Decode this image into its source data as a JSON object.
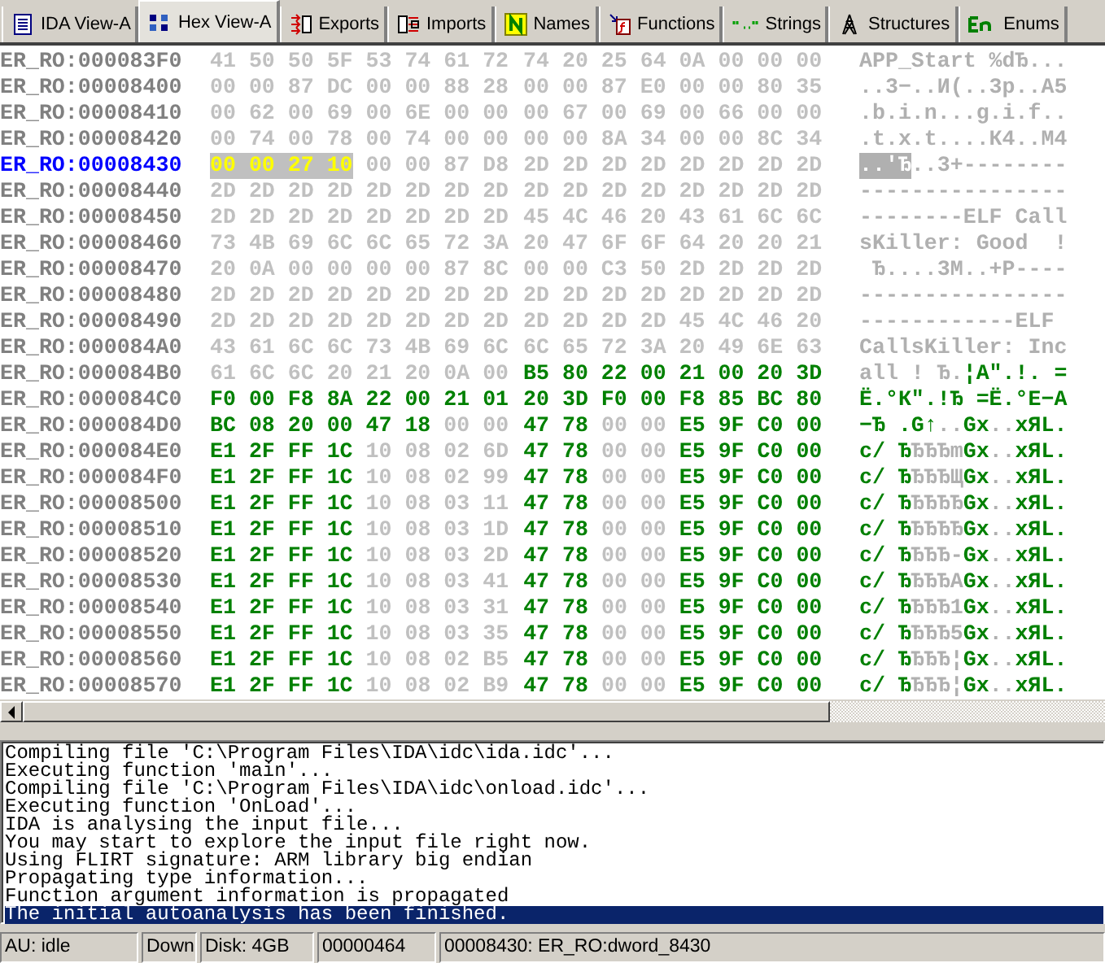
{
  "tabs": [
    {
      "label": "IDA View-A",
      "selected": false
    },
    {
      "label": "Hex View-A",
      "selected": true
    },
    {
      "label": "Exports",
      "selected": false
    },
    {
      "label": "Imports",
      "selected": false
    },
    {
      "label": "Names",
      "selected": false
    },
    {
      "label": "Functions",
      "selected": false
    },
    {
      "label": "Strings",
      "selected": false
    },
    {
      "label": "Structures",
      "selected": false
    },
    {
      "label": "Enums",
      "selected": false
    }
  ],
  "hex_rows": [
    {
      "address": "ER_RO:000083F0",
      "selected": false,
      "segments": [
        {
          "kind": "data",
          "hex": "41 50 50 5F 53 74 61 72",
          "ascii": "APP_Star"
        },
        {
          "kind": "data",
          "hex": "74 20 25 64 0A 00 00 00",
          "ascii": "t %dЂ..."
        }
      ]
    },
    {
      "address": "ER_RO:00008400",
      "selected": false,
      "segments": [
        {
          "kind": "data",
          "hex": "00 00 87 DC 00 00 88 28",
          "ascii": "..3−..И("
        },
        {
          "kind": "data",
          "hex": "00 00 87 E0 00 00 80 35",
          "ascii": "..3р..А5"
        }
      ]
    },
    {
      "address": "ER_RO:00008410",
      "selected": false,
      "segments": [
        {
          "kind": "data",
          "hex": "00 62 00 69 00 6E 00 00",
          "ascii": ".b.i.n.."
        },
        {
          "kind": "data",
          "hex": "00 67 00 69 00 66 00 00",
          "ascii": ".g.i.f.."
        }
      ]
    },
    {
      "address": "ER_RO:00008420",
      "selected": false,
      "segments": [
        {
          "kind": "data",
          "hex": "00 74 00 78 00 74 00 00",
          "ascii": ".t.x.t.."
        },
        {
          "kind": "data",
          "hex": "00 00 8A 34 00 00 8C 34",
          "ascii": "..К4..М4"
        }
      ]
    },
    {
      "address": "ER_RO:00008430",
      "selected": true,
      "segments": [
        {
          "kind": "cursor",
          "hex": "00 00 27 10",
          "ascii": "..'Ђ"
        },
        {
          "kind": "data",
          "hex": "00 00 87 D8",
          "ascii": "..3+"
        },
        {
          "kind": "data",
          "hex": "2D 2D 2D 2D 2D 2D 2D 2D",
          "ascii": "--------"
        }
      ]
    },
    {
      "address": "ER_RO:00008440",
      "selected": false,
      "segments": [
        {
          "kind": "data",
          "hex": "2D 2D 2D 2D 2D 2D 2D 2D",
          "ascii": "--------"
        },
        {
          "kind": "data",
          "hex": "2D 2D 2D 2D 2D 2D 2D 2D",
          "ascii": "--------"
        }
      ]
    },
    {
      "address": "ER_RO:00008450",
      "selected": false,
      "segments": [
        {
          "kind": "data",
          "hex": "2D 2D 2D 2D 2D 2D 2D 2D",
          "ascii": "--------"
        },
        {
          "kind": "data",
          "hex": "45 4C 46 20 43 61 6C 6C",
          "ascii": "ELF Call"
        }
      ]
    },
    {
      "address": "ER_RO:00008460",
      "selected": false,
      "segments": [
        {
          "kind": "data",
          "hex": "73 4B 69 6C 6C 65 72 3A",
          "ascii": "sKiller:"
        },
        {
          "kind": "data",
          "hex": "20 47 6F 6F 64 20 20 21",
          "ascii": " Good  !"
        }
      ]
    },
    {
      "address": "ER_RO:00008470",
      "selected": false,
      "segments": [
        {
          "kind": "data",
          "hex": "20 0A 00 00 00 00 87 8C",
          "ascii": " Ђ....3М"
        },
        {
          "kind": "data",
          "hex": "00 00 C3 50 2D 2D 2D 2D",
          "ascii": "..+P----"
        }
      ]
    },
    {
      "address": "ER_RO:00008480",
      "selected": false,
      "segments": [
        {
          "kind": "data",
          "hex": "2D 2D 2D 2D 2D 2D 2D 2D",
          "ascii": "--------"
        },
        {
          "kind": "data",
          "hex": "2D 2D 2D 2D 2D 2D 2D 2D",
          "ascii": "--------"
        }
      ]
    },
    {
      "address": "ER_RO:00008490",
      "selected": false,
      "segments": [
        {
          "kind": "data",
          "hex": "2D 2D 2D 2D 2D 2D 2D 2D",
          "ascii": "--------"
        },
        {
          "kind": "data",
          "hex": "2D 2D 2D 2D 45 4C 46 20",
          "ascii": "----ELF "
        }
      ]
    },
    {
      "address": "ER_RO:000084A0",
      "selected": false,
      "segments": [
        {
          "kind": "data",
          "hex": "43 61 6C 6C 73 4B 69 6C",
          "ascii": "CallsKil"
        },
        {
          "kind": "data",
          "hex": "6C 65 72 3A 20 49 6E 63",
          "ascii": "ler: Inc"
        }
      ]
    },
    {
      "address": "ER_RO:000084B0",
      "selected": false,
      "segments": [
        {
          "kind": "data",
          "hex": "61 6C 6C 20 21 20 0A 00",
          "ascii": "all ! Ђ."
        },
        {
          "kind": "code",
          "hex": "B5 80 22 00 21 00 20 3D",
          "ascii": "¦А\".!. ="
        }
      ]
    },
    {
      "address": "ER_RO:000084C0",
      "selected": false,
      "segments": [
        {
          "kind": "code",
          "hex": "F0 00 F8 8A 22 00 21 01",
          "ascii": "Ё.°К\".!Ђ"
        },
        {
          "kind": "code",
          "hex": "20 3D F0 00 F8 85 BC 80",
          "ascii": " =Ё.°Е−А"
        }
      ]
    },
    {
      "address": "ER_RO:000084D0",
      "selected": false,
      "segments": [
        {
          "kind": "code",
          "hex": "BC 08 20 00 47 18",
          "ascii": "−Ђ .G↑"
        },
        {
          "kind": "data",
          "hex": "00 00",
          "ascii": ".."
        },
        {
          "kind": "code",
          "hex": "47 78",
          "ascii": "Gx"
        },
        {
          "kind": "data",
          "hex": "00 00",
          "ascii": ".."
        },
        {
          "kind": "code",
          "hex": "E5 9F C0 00",
          "ascii": "xЯL."
        }
      ]
    },
    {
      "address": "ER_RO:000084E0",
      "selected": false,
      "segments": [
        {
          "kind": "code",
          "hex": "E1 2F FF 1C",
          "ascii": "c/ Ђ"
        },
        {
          "kind": "data",
          "hex": "10 08 02 6D",
          "ascii": "ЂЂЂm"
        },
        {
          "kind": "code",
          "hex": "47 78",
          "ascii": "Gx"
        },
        {
          "kind": "data",
          "hex": "00 00",
          "ascii": ".."
        },
        {
          "kind": "code",
          "hex": "E5 9F C0 00",
          "ascii": "xЯL."
        }
      ]
    },
    {
      "address": "ER_RO:000084F0",
      "selected": false,
      "segments": [
        {
          "kind": "code",
          "hex": "E1 2F FF 1C",
          "ascii": "c/ Ђ"
        },
        {
          "kind": "data",
          "hex": "10 08 02 99",
          "ascii": "ЂЂЂЩ"
        },
        {
          "kind": "code",
          "hex": "47 78",
          "ascii": "Gx"
        },
        {
          "kind": "data",
          "hex": "00 00",
          "ascii": ".."
        },
        {
          "kind": "code",
          "hex": "E5 9F C0 00",
          "ascii": "xЯL."
        }
      ]
    },
    {
      "address": "ER_RO:00008500",
      "selected": false,
      "segments": [
        {
          "kind": "code",
          "hex": "E1 2F FF 1C",
          "ascii": "c/ Ђ"
        },
        {
          "kind": "data",
          "hex": "10 08 03 11",
          "ascii": "ЂЂЂЂ"
        },
        {
          "kind": "code",
          "hex": "47 78",
          "ascii": "Gx"
        },
        {
          "kind": "data",
          "hex": "00 00",
          "ascii": ".."
        },
        {
          "kind": "code",
          "hex": "E5 9F C0 00",
          "ascii": "xЯL."
        }
      ]
    },
    {
      "address": "ER_RO:00008510",
      "selected": false,
      "segments": [
        {
          "kind": "code",
          "hex": "E1 2F FF 1C",
          "ascii": "c/ Ђ"
        },
        {
          "kind": "data",
          "hex": "10 08 03 1D",
          "ascii": "ЂЂЂЂ"
        },
        {
          "kind": "code",
          "hex": "47 78",
          "ascii": "Gx"
        },
        {
          "kind": "data",
          "hex": "00 00",
          "ascii": ".."
        },
        {
          "kind": "code",
          "hex": "E5 9F C0 00",
          "ascii": "xЯL."
        }
      ]
    },
    {
      "address": "ER_RO:00008520",
      "selected": false,
      "segments": [
        {
          "kind": "code",
          "hex": "E1 2F FF 1C",
          "ascii": "c/ Ђ"
        },
        {
          "kind": "data",
          "hex": "10 08 03 2D",
          "ascii": "ЂЂЂ-"
        },
        {
          "kind": "code",
          "hex": "47 78",
          "ascii": "Gx"
        },
        {
          "kind": "data",
          "hex": "00 00",
          "ascii": ".."
        },
        {
          "kind": "code",
          "hex": "E5 9F C0 00",
          "ascii": "xЯL."
        }
      ]
    },
    {
      "address": "ER_RO:00008530",
      "selected": false,
      "segments": [
        {
          "kind": "code",
          "hex": "E1 2F FF 1C",
          "ascii": "c/ Ђ"
        },
        {
          "kind": "data",
          "hex": "10 08 03 41",
          "ascii": "ЂЂЂA"
        },
        {
          "kind": "code",
          "hex": "47 78",
          "ascii": "Gx"
        },
        {
          "kind": "data",
          "hex": "00 00",
          "ascii": ".."
        },
        {
          "kind": "code",
          "hex": "E5 9F C0 00",
          "ascii": "xЯL."
        }
      ]
    },
    {
      "address": "ER_RO:00008540",
      "selected": false,
      "segments": [
        {
          "kind": "code",
          "hex": "E1 2F FF 1C",
          "ascii": "c/ Ђ"
        },
        {
          "kind": "data",
          "hex": "10 08 03 31",
          "ascii": "ЂЂЂ1"
        },
        {
          "kind": "code",
          "hex": "47 78",
          "ascii": "Gx"
        },
        {
          "kind": "data",
          "hex": "00 00",
          "ascii": ".."
        },
        {
          "kind": "code",
          "hex": "E5 9F C0 00",
          "ascii": "xЯL."
        }
      ]
    },
    {
      "address": "ER_RO:00008550",
      "selected": false,
      "segments": [
        {
          "kind": "code",
          "hex": "E1 2F FF 1C",
          "ascii": "c/ Ђ"
        },
        {
          "kind": "data",
          "hex": "10 08 03 35",
          "ascii": "ЂЂЂ5"
        },
        {
          "kind": "code",
          "hex": "47 78",
          "ascii": "Gx"
        },
        {
          "kind": "data",
          "hex": "00 00",
          "ascii": ".."
        },
        {
          "kind": "code",
          "hex": "E5 9F C0 00",
          "ascii": "xЯL."
        }
      ]
    },
    {
      "address": "ER_RO:00008560",
      "selected": false,
      "segments": [
        {
          "kind": "code",
          "hex": "E1 2F FF 1C",
          "ascii": "c/ Ђ"
        },
        {
          "kind": "data",
          "hex": "10 08 02 B5",
          "ascii": "ЂЂЂ¦"
        },
        {
          "kind": "code",
          "hex": "47 78",
          "ascii": "Gx"
        },
        {
          "kind": "data",
          "hex": "00 00",
          "ascii": ".."
        },
        {
          "kind": "code",
          "hex": "E5 9F C0 00",
          "ascii": "xЯL."
        }
      ]
    },
    {
      "address": "ER_RO:00008570",
      "selected": false,
      "segments": [
        {
          "kind": "code",
          "hex": "E1 2F FF 1C",
          "ascii": "c/ Ђ"
        },
        {
          "kind": "data",
          "hex": "10 08 02 B9",
          "ascii": "ЂЂЂ¦"
        },
        {
          "kind": "code",
          "hex": "47 78",
          "ascii": "Gx"
        },
        {
          "kind": "data",
          "hex": "00 00",
          "ascii": ".."
        },
        {
          "kind": "code",
          "hex": "E5 9F C0 00",
          "ascii": "xЯL."
        }
      ]
    }
  ],
  "output_lines": [
    {
      "text": "Compiling file 'C:\\Program Files\\IDA\\idc\\ida.idc'...",
      "selected": false
    },
    {
      "text": "Executing function 'main'...",
      "selected": false
    },
    {
      "text": "Compiling file 'C:\\Program Files\\IDA\\idc\\onload.idc'...",
      "selected": false
    },
    {
      "text": "Executing function 'OnLoad'...",
      "selected": false
    },
    {
      "text": "IDA is analysing the input file...",
      "selected": false
    },
    {
      "text": "You may start to explore the input file right now.",
      "selected": false
    },
    {
      "text": "Using FLIRT signature: ARM library big endian",
      "selected": false
    },
    {
      "text": "Propagating type information...",
      "selected": false
    },
    {
      "text": "Function argument information is propagated",
      "selected": false
    },
    {
      "text": "The initial autoanalysis has been finished.",
      "selected": true
    }
  ],
  "status_bar": [
    "AU:  idle",
    "Down",
    "Disk: 4GB",
    "00000464",
    "00008430: ER_RO:dword_8430"
  ]
}
